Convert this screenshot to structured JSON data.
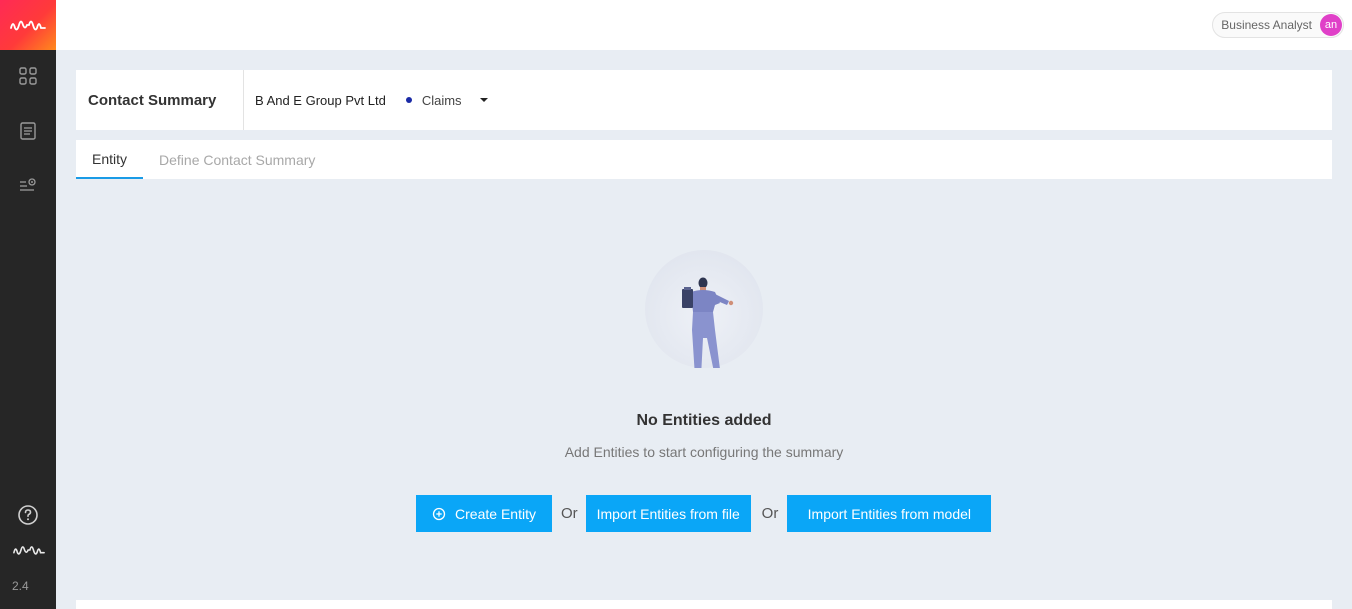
{
  "rail": {
    "version": "2.4",
    "icons": [
      "brand-wave-icon",
      "dashboard-grid-icon",
      "document-list-icon",
      "settings-list-icon",
      "help-icon",
      "brand-wave-icon"
    ]
  },
  "topbar": {
    "user_role": "Business Analyst",
    "avatar_initials": "an"
  },
  "header": {
    "title": "Contact Summary",
    "company": "B And E Group Pvt Ltd",
    "scope": "Claims"
  },
  "tabs": [
    {
      "label": "Entity",
      "active": true
    },
    {
      "label": "Define Contact Summary",
      "active": false
    }
  ],
  "empty_state": {
    "title": "No Entities added",
    "subtitle": "Add Entities to start configuring the summary"
  },
  "actions": {
    "create_label": "Create Entity",
    "or_label": "Or",
    "import_file_label": "Import Entities from file",
    "import_model_label": "Import Entities from model"
  },
  "colors": {
    "accent": "#0aa6f7",
    "rail": "#262626",
    "avatar": "#e040c8",
    "scope_dot": "#1a2aa6"
  }
}
